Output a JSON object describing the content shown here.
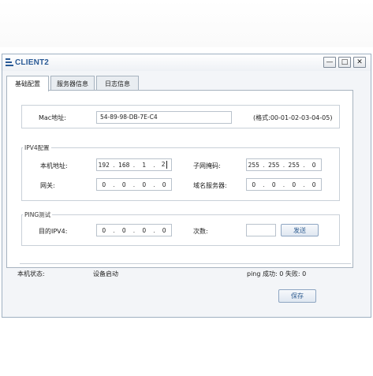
{
  "window": {
    "title": "CLIENT2"
  },
  "window_controls": {
    "minimize": "—",
    "maximize": "□",
    "close": "✕"
  },
  "tabs": [
    {
      "label": "基础配置",
      "active": true
    },
    {
      "label": "服务器信息",
      "active": false
    },
    {
      "label": "日志信息",
      "active": false
    }
  ],
  "mac": {
    "label": "Mac地址:",
    "value": "54-89-98-DB-7E-C4",
    "format_hint": "(格式:00-01-02-03-04-05)"
  },
  "ipv4": {
    "section_title": "IPV4配置",
    "ip_label": "本机地址:",
    "ip_value": [
      "192",
      "168",
      "1",
      "2"
    ],
    "mask_label": "子网掩码:",
    "mask_value": [
      "255",
      "255",
      "255",
      "0"
    ],
    "gateway_label": "网关:",
    "gateway_value": [
      "0",
      "0",
      "0",
      "0"
    ],
    "dns_label": "域名服务器:",
    "dns_value": [
      "0",
      "0",
      "0",
      "0"
    ]
  },
  "ping": {
    "section_title": "PING测试",
    "target_label": "目的IPV4:",
    "target_value": [
      "0",
      "0",
      "0",
      "0"
    ],
    "count_label": "次数:",
    "count_value": "",
    "send_button": "发送"
  },
  "status": {
    "label": "本机状态:",
    "value": "设备启动",
    "ping_result": "ping 成功: 0 失败: 0"
  },
  "save_button": "保存"
}
